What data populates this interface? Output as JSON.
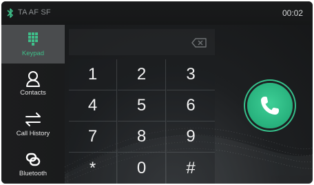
{
  "status": {
    "indicators": "TA  AF  SF",
    "time": "00:02",
    "bt_icon": "bluetooth-icon"
  },
  "sidebar": {
    "items": [
      {
        "label": "Keypad",
        "icon": "keypad-icon",
        "active": true
      },
      {
        "label": "Contacts",
        "icon": "contact-icon",
        "active": false
      },
      {
        "label": "Call History",
        "icon": "swap-arrows-icon",
        "active": false
      },
      {
        "label": "Bluetooth",
        "icon": "link-icon",
        "active": false
      }
    ]
  },
  "keypad": {
    "display_value": "",
    "backspace_icon": "backspace-icon",
    "keys": [
      "1",
      "2",
      "3",
      "4",
      "5",
      "6",
      "7",
      "8",
      "9",
      "*",
      "0",
      "#"
    ]
  },
  "call": {
    "icon": "phone-icon"
  },
  "colors": {
    "accent": "#3fbf8a",
    "call_green": "#2bb27f",
    "active_tab_bg": "#4a4c4e"
  }
}
